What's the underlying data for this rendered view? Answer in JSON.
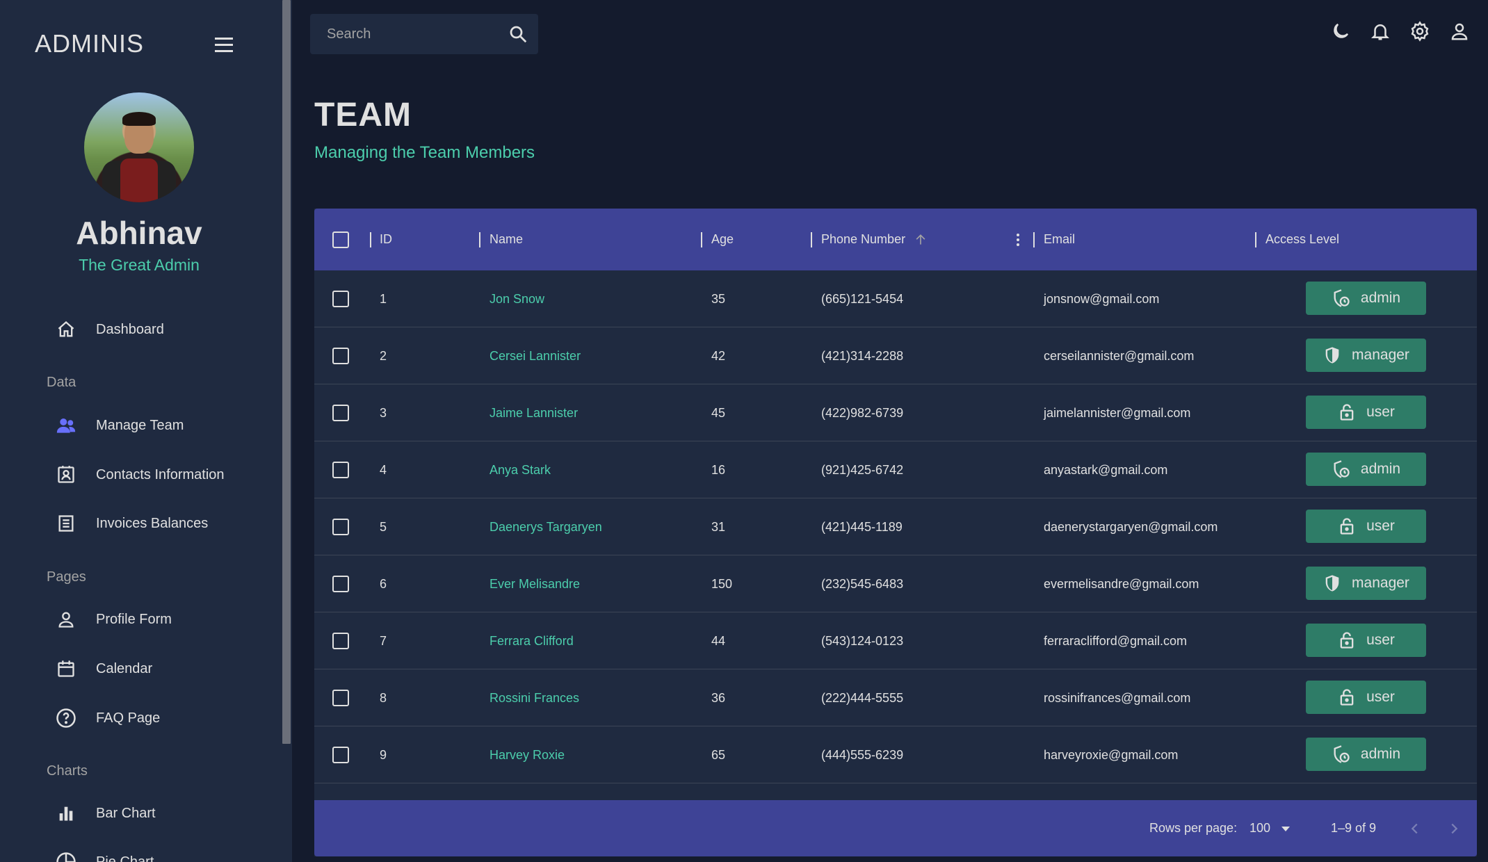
{
  "sidebar": {
    "brand": "ADMINIS",
    "profile_name": "Abhinav",
    "profile_role": "The Great Admin",
    "items": [
      {
        "label": "Dashboard"
      },
      {
        "section": "Data"
      },
      {
        "label": "Manage Team"
      },
      {
        "label": "Contacts Information"
      },
      {
        "label": "Invoices Balances"
      },
      {
        "section": "Pages"
      },
      {
        "label": "Profile Form"
      },
      {
        "label": "Calendar"
      },
      {
        "label": "FAQ Page"
      },
      {
        "section": "Charts"
      },
      {
        "label": "Bar Chart"
      },
      {
        "label": "Pie Chart"
      }
    ]
  },
  "topbar": {
    "search_placeholder": "Search",
    "icons": [
      "moon-icon",
      "bell-icon",
      "gear-icon",
      "user-icon"
    ]
  },
  "header": {
    "title": "TEAM",
    "subtitle": "Managing the Team Members"
  },
  "table": {
    "columns": [
      "ID",
      "Name",
      "Age",
      "Phone Number",
      "Email",
      "Access Level"
    ],
    "rows": [
      {
        "id": "1",
        "name": "Jon Snow",
        "age": "35",
        "phone": "(665)121-5454",
        "email": "jonsnow@gmail.com",
        "access": "admin"
      },
      {
        "id": "2",
        "name": "Cersei Lannister",
        "age": "42",
        "phone": "(421)314-2288",
        "email": "cerseilannister@gmail.com",
        "access": "manager"
      },
      {
        "id": "3",
        "name": "Jaime Lannister",
        "age": "45",
        "phone": "(422)982-6739",
        "email": "jaimelannister@gmail.com",
        "access": "user"
      },
      {
        "id": "4",
        "name": "Anya Stark",
        "age": "16",
        "phone": "(921)425-6742",
        "email": "anyastark@gmail.com",
        "access": "admin"
      },
      {
        "id": "5",
        "name": "Daenerys Targaryen",
        "age": "31",
        "phone": "(421)445-1189",
        "email": "daenerystargaryen@gmail.com",
        "access": "user"
      },
      {
        "id": "6",
        "name": "Ever Melisandre",
        "age": "150",
        "phone": "(232)545-6483",
        "email": "evermelisandre@gmail.com",
        "access": "manager"
      },
      {
        "id": "7",
        "name": "Ferrara Clifford",
        "age": "44",
        "phone": "(543)124-0123",
        "email": "ferraraclifford@gmail.com",
        "access": "user"
      },
      {
        "id": "8",
        "name": "Rossini Frances",
        "age": "36",
        "phone": "(222)444-5555",
        "email": "rossinifrances@gmail.com",
        "access": "user"
      },
      {
        "id": "9",
        "name": "Harvey Roxie",
        "age": "65",
        "phone": "(444)555-6239",
        "email": "harveyroxie@gmail.com",
        "access": "admin"
      }
    ],
    "footer": {
      "rows_per_page_label": "Rows per page:",
      "rows_per_page_value": "100",
      "range": "1–9 of 9"
    }
  },
  "colors": {
    "background": "#141b2d",
    "panel": "#1f2a40",
    "header": "#3e4396",
    "accent": "#4cceac",
    "button": "#2e7c67",
    "active_nav": "#6870fa"
  }
}
